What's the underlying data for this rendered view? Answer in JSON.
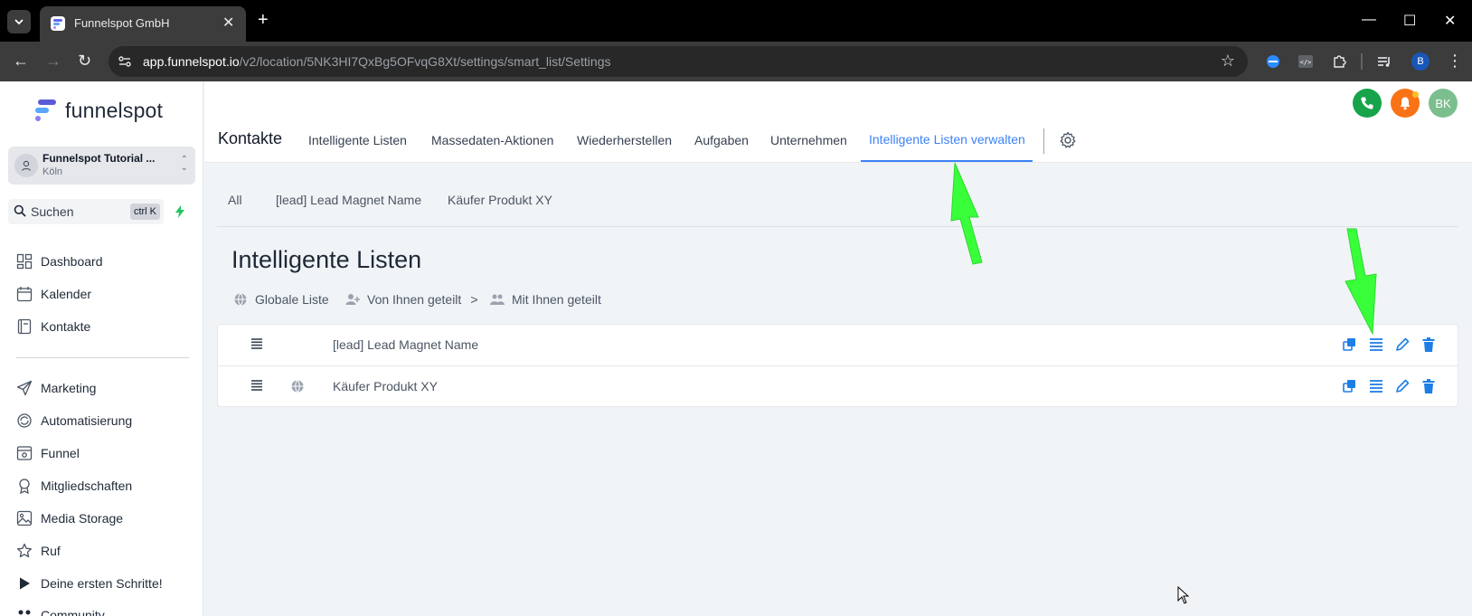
{
  "browser": {
    "tab_title": "Funnelspot GmbH",
    "url_host": "app.funnelspot.io",
    "url_path": "/v2/location/5NK3HI7QxBg5OFvqG8Xt/settings/smart_list/Settings",
    "profile_initial": "B"
  },
  "sidebar": {
    "logo_text": "funnelspot",
    "location_name": "Funnelspot Tutorial ...",
    "location_city": "Köln",
    "search_label": "Suchen",
    "search_shortcut": "ctrl K",
    "items": [
      {
        "label": "Dashboard",
        "icon": "dashboard-icon"
      },
      {
        "label": "Kalender",
        "icon": "calendar-icon"
      },
      {
        "label": "Kontakte",
        "icon": "contacts-icon"
      },
      {
        "label": "Marketing",
        "icon": "send-icon"
      },
      {
        "label": "Automatisierung",
        "icon": "automation-icon"
      },
      {
        "label": "Funnel",
        "icon": "funnel-icon"
      },
      {
        "label": "Mitgliedschaften",
        "icon": "membership-icon"
      },
      {
        "label": "Media Storage",
        "icon": "image-icon"
      },
      {
        "label": "Ruf",
        "icon": "star-icon"
      },
      {
        "label": "Deine ersten Schritte!",
        "icon": "play-icon"
      },
      {
        "label": "Community",
        "icon": "community-icon"
      }
    ]
  },
  "header": {
    "avatar_initials": "BK",
    "title": "Kontakte",
    "tabs": [
      {
        "label": "Intelligente Listen"
      },
      {
        "label": "Massedaten-Aktionen"
      },
      {
        "label": "Wiederherstellen"
      },
      {
        "label": "Aufgaben"
      },
      {
        "label": "Unternehmen"
      },
      {
        "label": "Intelligente Listen verwalten",
        "active": true
      }
    ]
  },
  "filters": [
    "All",
    "[lead] Lead Magnet Name",
    "Käufer Produkt XY"
  ],
  "smart_lists": {
    "heading": "Intelligente Listen",
    "share_tabs": [
      "Globale Liste",
      "Von Ihnen geteilt",
      "Mit Ihnen geteilt"
    ],
    "share_separator": ">",
    "rows": [
      {
        "name": "[lead] Lead Magnet Name",
        "global": false
      },
      {
        "name": "Käufer Produkt XY",
        "global": true
      }
    ]
  },
  "colors": {
    "accent": "#3b82f6",
    "action_blue": "#1d7fe6",
    "phone_green": "#16a34a",
    "bell_orange": "#f97316",
    "avatar_green": "#7bbf8e",
    "annotation_arrow": "#39ff3a"
  }
}
